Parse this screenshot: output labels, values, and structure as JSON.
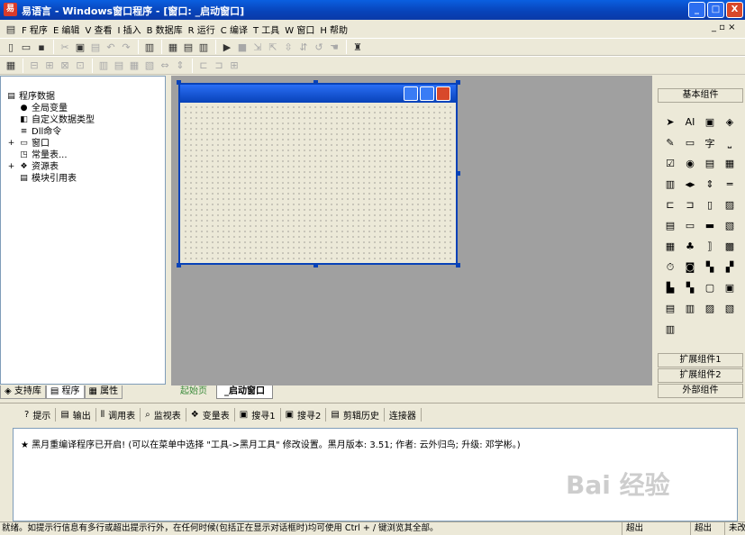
{
  "titlebar": {
    "title": "易语言 - Windows窗口程序 - [窗口: _启动窗口]",
    "min": "_",
    "max": "□",
    "close": "X"
  },
  "menus": [
    "F 程序",
    "E 编辑",
    "V 查看",
    "I 插入",
    "B 数据库",
    "R 运行",
    "C 编译",
    "T 工具",
    "W 窗口",
    "H 帮助"
  ],
  "mdi_controls": "_ ▫ ×",
  "tree": {
    "root": "程序数据",
    "items": [
      {
        "icon": "●",
        "label": "全局变量"
      },
      {
        "icon": "◧",
        "label": "自定义数据类型"
      },
      {
        "icon": "≡",
        "label": "Dll命令"
      },
      {
        "icon": "▭",
        "label": "窗口",
        "expand": "+"
      },
      {
        "icon": "◳",
        "label": "常量表..."
      },
      {
        "icon": "❖",
        "label": "资源表",
        "expand": "+"
      },
      {
        "icon": "▤",
        "label": "模块引用表"
      }
    ]
  },
  "left_tabs": [
    "支持库",
    "程序",
    "属性"
  ],
  "doc_tabs": [
    "起始页",
    "_启动窗口"
  ],
  "right": {
    "header": "基本组件",
    "footers": [
      "扩展组件1",
      "扩展组件2",
      "外部组件"
    ],
    "controls": [
      "➤",
      "AI",
      "▣",
      "◈",
      "✎",
      "▭",
      "字",
      "⎵",
      "☑",
      "◉",
      "▤",
      "▦",
      "▥",
      "◂▸",
      "⇕",
      "═",
      "⊏",
      "⊐",
      "▯",
      "▨",
      "▤",
      "▭",
      "▬",
      "▧",
      "▦",
      "♣",
      "⟧",
      "▩",
      "⏱",
      "◙",
      "▚",
      "▞",
      "▙",
      "▚",
      "▢",
      "▣",
      "▤",
      "▥",
      "▨",
      "▧",
      "▥"
    ]
  },
  "output": {
    "tabs": [
      "提示",
      "输出",
      "调用表",
      "监视表",
      "变量表",
      "搜寻1",
      "搜寻2",
      "剪辑历史",
      "连接器"
    ],
    "message": "★ 黑月重编译程序已开启! (可以在菜单中选择 \"工具->黑月工具\" 修改设置。黑月版本: 3.51; 作者: 云外归鸟; 升级: 邓学彬。)"
  },
  "status": {
    "text": "就绪。如提示行信息有多行或超出提示行外，在任何时候(包括正在显示对话框时)均可使用 Ctrl + / 键浏览其全部。",
    "cells": [
      "超出",
      "超出",
      "未改"
    ]
  },
  "watermark": "Bai 经验"
}
